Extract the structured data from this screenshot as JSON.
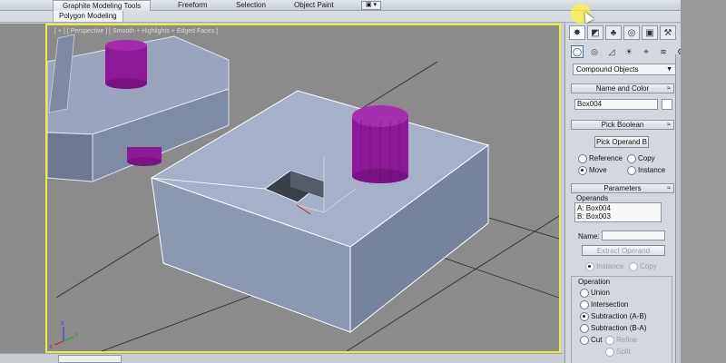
{
  "ribbon": {
    "tabs": [
      {
        "label": "Graphite Modeling Tools",
        "active": true
      },
      {
        "label": "Freeform",
        "active": false
      },
      {
        "label": "Selection",
        "active": false
      },
      {
        "label": "Object Paint",
        "active": false
      }
    ],
    "subtab": "Polygon Modeling"
  },
  "viewport": {
    "label": "[ + ] [ Perspective ] [ Smooth + Highlights + Edged Faces ]",
    "axis_labels": {
      "x": "x",
      "y": "y",
      "z": "z"
    }
  },
  "panel": {
    "tabs": [
      "create-tab",
      "modify-tab",
      "hierarchy-tab",
      "motion-tab",
      "display-tab",
      "utilities-tab"
    ],
    "tab_glyphs": [
      "✸",
      "◩",
      "♣",
      "◎",
      "▣",
      "⚒"
    ],
    "category_glyphs": [
      "◯",
      "◎",
      "◿",
      "☀",
      "⌖",
      "≋",
      "⚙"
    ],
    "category_dropdown": "Compound Objects",
    "name_color": {
      "header": "Name and Color",
      "name_value": "Box004"
    },
    "pick_boolean": {
      "header": "Pick Boolean",
      "button": "Pick Operand B",
      "options": [
        {
          "label": "Reference",
          "selected": false
        },
        {
          "label": "Copy",
          "selected": false
        },
        {
          "label": "Move",
          "selected": true
        },
        {
          "label": "Instance",
          "selected": false
        }
      ]
    },
    "parameters": {
      "header": "Parameters",
      "operands_label": "Operands",
      "operands": [
        "A: Box004",
        "B: Box003"
      ],
      "name_label": "Name:",
      "name_value": "",
      "extract_button": "Extract Operand",
      "extract_options": [
        {
          "label": "Instance",
          "selected": true
        },
        {
          "label": "Copy",
          "selected": false
        }
      ],
      "operation_label": "Operation",
      "operations": [
        {
          "label": "Union",
          "selected": false
        },
        {
          "label": "Intersection",
          "selected": false
        },
        {
          "label": "Subtraction (A-B)",
          "selected": true
        },
        {
          "label": "Subtraction (B-A)",
          "selected": false
        },
        {
          "label": "Cut",
          "selected": false
        }
      ],
      "cut_options": [
        {
          "label": "Refine",
          "selected": false
        },
        {
          "label": "Split",
          "selected": false
        }
      ]
    }
  },
  "colors": {
    "viewport_border": "#f0e940",
    "viewport_bg": "#8b8b8b",
    "box": "#a6b0c8",
    "cylinder": "#8c1a96"
  }
}
